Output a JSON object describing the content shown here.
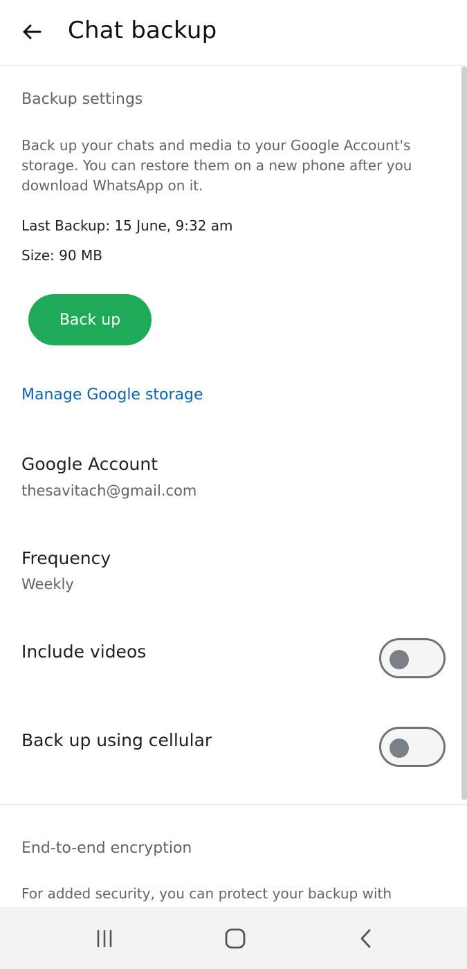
{
  "header": {
    "title": "Chat backup",
    "back_icon": "arrow-left-icon"
  },
  "backup_settings": {
    "header": "Backup settings",
    "description": "Back up your chats and media to your Google Account's storage. You can restore them on a new phone after you download WhatsApp on it.",
    "last_backup": "Last Backup: 15 June, 9:32 am",
    "size": "Size: 90 MB",
    "backup_button": "Back up",
    "manage_link": "Manage Google storage"
  },
  "google_account": {
    "title": "Google Account",
    "value": "thesavitach@gmail.com"
  },
  "frequency": {
    "title": "Frequency",
    "value": "Weekly"
  },
  "include_videos": {
    "title": "Include videos",
    "enabled": false
  },
  "cellular": {
    "title": "Back up using cellular",
    "enabled": false
  },
  "encryption": {
    "header": "End-to-end encryption",
    "description": "For added security, you can protect your backup with"
  },
  "nav_bar": {
    "recents_icon": "recents-icon",
    "home_icon": "home-icon",
    "back_icon": "nav-back-icon"
  },
  "colors": {
    "accent_green": "#1faa59",
    "link_blue": "#0b62b0"
  }
}
